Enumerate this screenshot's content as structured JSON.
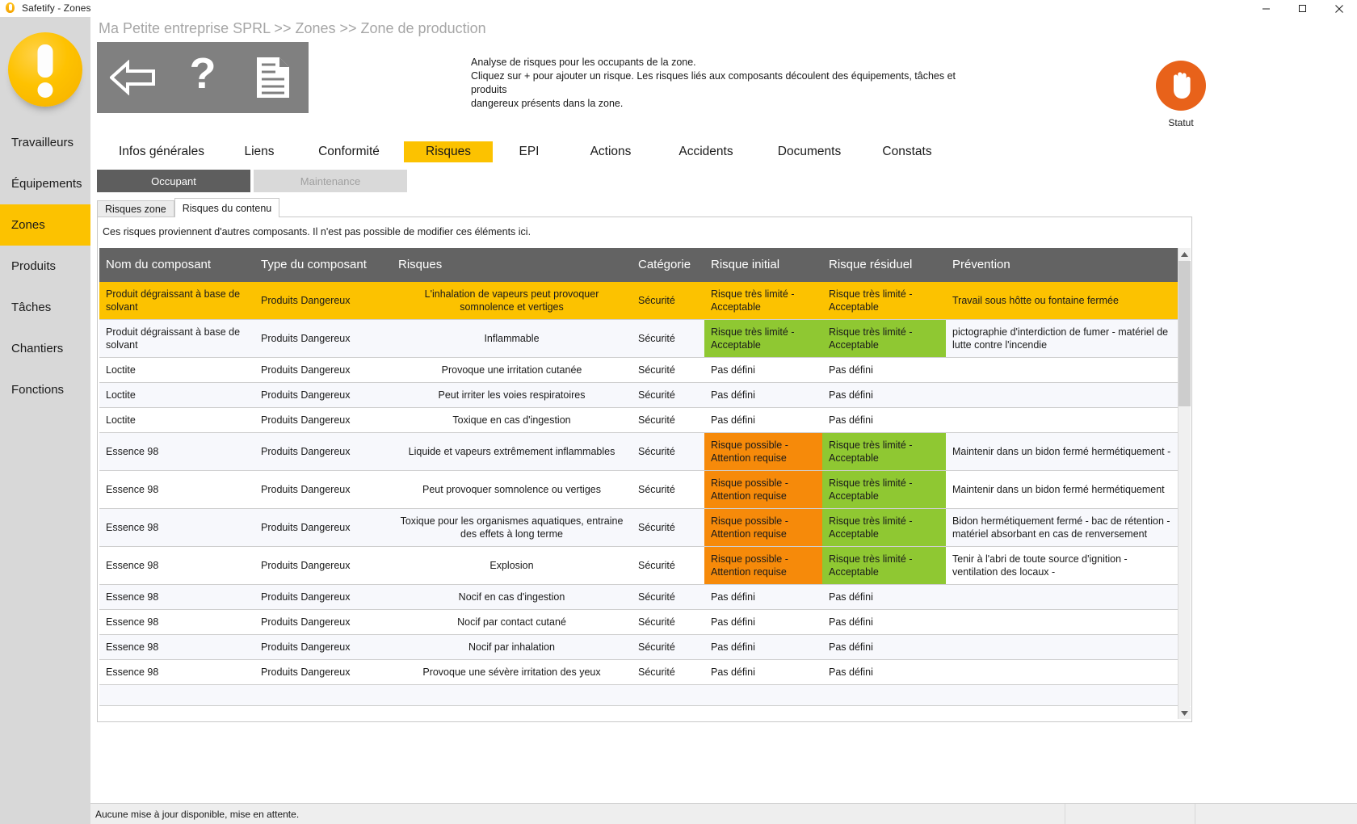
{
  "window": {
    "title": "Safetify - Zones",
    "app_icon": "bulb-icon",
    "minimize_label": "–",
    "maximize_label": "□",
    "close_label": "✕"
  },
  "sidebar": {
    "logo_name": "safetify-logo",
    "items": [
      {
        "label": "Travailleurs",
        "active": false
      },
      {
        "label": "Équipements",
        "active": false
      },
      {
        "label": "Zones",
        "active": true
      },
      {
        "label": "Produits",
        "active": false
      },
      {
        "label": "Tâches",
        "active": false
      },
      {
        "label": "Chantiers",
        "active": false
      },
      {
        "label": "Fonctions",
        "active": false
      }
    ]
  },
  "header": {
    "breadcrumb": "Ma Petite entreprise SPRL >> Zones >> Zone de production",
    "toolbar": [
      {
        "name": "back-icon",
        "label": "Retour"
      },
      {
        "name": "help-icon",
        "label": "Aide"
      },
      {
        "name": "report-icon",
        "label": "Rapport"
      }
    ],
    "description_lines": [
      "Analyse de risques pour les occupants de la zone.",
      "Cliquez sur + pour ajouter un risque. Les risques liés aux composants découlent des équipements, tâches et produits",
      "dangereux présents dans la zone."
    ],
    "status": {
      "label": "Statut",
      "icon": "hand-stop-icon",
      "color": "#e8621a"
    }
  },
  "tabs": {
    "main": [
      {
        "label": "Infos générales",
        "active": false
      },
      {
        "label": "Liens",
        "active": false
      },
      {
        "label": "Conformité",
        "active": false
      },
      {
        "label": "Risques",
        "active": true
      },
      {
        "label": "EPI",
        "active": false
      },
      {
        "label": "Actions",
        "active": false
      },
      {
        "label": "Accidents",
        "active": false
      },
      {
        "label": "Documents",
        "active": false
      },
      {
        "label": "Constats",
        "active": false
      }
    ],
    "sub": [
      {
        "label": "Occupant",
        "active": true
      },
      {
        "label": "Maintenance",
        "active": false
      }
    ],
    "inner": [
      {
        "label": "Risques zone",
        "active": false
      },
      {
        "label": "Risques du contenu",
        "active": true
      }
    ]
  },
  "panel": {
    "note": "Ces risques proviennent d'autres composants. Il n'est pas possible de modifier ces éléments ici."
  },
  "table": {
    "columns": [
      "Nom du composant",
      "Type du composant",
      "Risques",
      "Catégorie",
      "Risque initial",
      "Risque résiduel",
      "Prévention"
    ],
    "rows": [
      {
        "name": "Produit dégraissant à base de solvant",
        "type": "Produits Dangereux",
        "risk": "L'inhalation de vapeurs peut provoquer somnolence et vertiges",
        "category": "Sécurité",
        "initial": "Risque très limité - Acceptable",
        "initial_fill": "selected",
        "residual": "Risque très limité - Acceptable",
        "residual_fill": "selected",
        "prevention": "Travail sous hôtte ou fontaine fermée",
        "selected": true,
        "alt": false
      },
      {
        "name": "Produit dégraissant à base de solvant",
        "type": "Produits Dangereux",
        "risk": "Inflammable",
        "category": "Sécurité",
        "initial": "Risque très limité - Acceptable",
        "initial_fill": "green",
        "residual": "Risque très limité - Acceptable",
        "residual_fill": "green",
        "prevention": "pictographie d'interdiction de fumer - matériel de lutte contre l'incendie",
        "selected": false,
        "alt": true
      },
      {
        "name": "Loctite",
        "type": "Produits Dangereux",
        "risk": "Provoque une irritation cutanée",
        "category": "Sécurité",
        "initial": "Pas défini",
        "initial_fill": "none",
        "residual": "Pas défini",
        "residual_fill": "none",
        "prevention": "",
        "selected": false,
        "alt": false
      },
      {
        "name": "Loctite",
        "type": "Produits Dangereux",
        "risk": "Peut irriter les voies respiratoires",
        "category": "Sécurité",
        "initial": "Pas défini",
        "initial_fill": "none",
        "residual": "Pas défini",
        "residual_fill": "none",
        "prevention": "",
        "selected": false,
        "alt": true
      },
      {
        "name": "Loctite",
        "type": "Produits Dangereux",
        "risk": "Toxique en cas d'ingestion",
        "category": "Sécurité",
        "initial": "Pas défini",
        "initial_fill": "none",
        "residual": "Pas défini",
        "residual_fill": "none",
        "prevention": "",
        "selected": false,
        "alt": false
      },
      {
        "name": "Essence 98",
        "type": "Produits Dangereux",
        "risk": "Liquide et vapeurs extrêmement inflammables",
        "category": "Sécurité",
        "initial": "Risque possible - Attention requise",
        "initial_fill": "orange",
        "residual": "Risque très limité - Acceptable",
        "residual_fill": "green",
        "prevention": "Maintenir dans un bidon fermé hermétiquement -",
        "selected": false,
        "alt": true
      },
      {
        "name": "Essence 98",
        "type": "Produits Dangereux",
        "risk": "Peut provoquer somnolence ou vertiges",
        "category": "Sécurité",
        "initial": "Risque possible - Attention requise",
        "initial_fill": "orange",
        "residual": "Risque très limité - Acceptable",
        "residual_fill": "green",
        "prevention": "Maintenir dans un bidon fermé hermétiquement",
        "selected": false,
        "alt": false
      },
      {
        "name": "Essence 98",
        "type": "Produits Dangereux",
        "risk": "Toxique pour les organismes aquatiques, entraine des effets à long terme",
        "category": "Sécurité",
        "initial": "Risque possible - Attention requise",
        "initial_fill": "orange",
        "residual": "Risque très limité - Acceptable",
        "residual_fill": "green",
        "prevention": "Bidon hermétiquement fermé - bac de rétention - matériel absorbant en cas de renversement",
        "selected": false,
        "alt": true
      },
      {
        "name": "Essence 98",
        "type": "Produits Dangereux",
        "risk": "Explosion",
        "category": "Sécurité",
        "initial": "Risque possible - Attention requise",
        "initial_fill": "orange",
        "residual": "Risque très limité - Acceptable",
        "residual_fill": "green",
        "prevention": "Tenir à l'abri de toute source d'ignition - ventilation des locaux -",
        "selected": false,
        "alt": false
      },
      {
        "name": "Essence 98",
        "type": "Produits Dangereux",
        "risk": "Nocif en cas d'ingestion",
        "category": "Sécurité",
        "initial": "Pas défini",
        "initial_fill": "none",
        "residual": "Pas défini",
        "residual_fill": "none",
        "prevention": "",
        "selected": false,
        "alt": true
      },
      {
        "name": "Essence 98",
        "type": "Produits Dangereux",
        "risk": "Nocif par contact cutané",
        "category": "Sécurité",
        "initial": "Pas défini",
        "initial_fill": "none",
        "residual": "Pas défini",
        "residual_fill": "none",
        "prevention": "",
        "selected": false,
        "alt": false
      },
      {
        "name": "Essence 98",
        "type": "Produits Dangereux",
        "risk": "Nocif par inhalation",
        "category": "Sécurité",
        "initial": "Pas défini",
        "initial_fill": "none",
        "residual": "Pas défini",
        "residual_fill": "none",
        "prevention": "",
        "selected": false,
        "alt": true
      },
      {
        "name": "Essence 98",
        "type": "Produits Dangereux",
        "risk": "Provoque une sévère irritation des yeux",
        "category": "Sécurité",
        "initial": "Pas défini",
        "initial_fill": "none",
        "residual": "Pas défini",
        "residual_fill": "none",
        "prevention": "",
        "selected": false,
        "alt": false
      }
    ]
  },
  "statusbar": {
    "message": "Aucune mise à jour disponible, mise en attente."
  },
  "colors": {
    "accent_yellow": "#fcc200",
    "risk_green": "#8fc832",
    "risk_orange": "#f68a0a",
    "header_gray": "#636363",
    "toolbar_gray": "#808080",
    "sidebar_gray": "#d8d8d8",
    "status_orange": "#e8621a"
  }
}
